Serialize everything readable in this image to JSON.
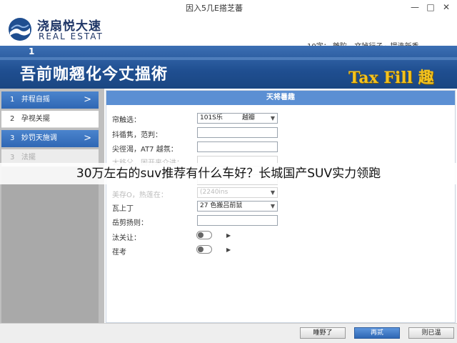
{
  "window": {
    "title": "因入5几E搭芝蕃",
    "controls": {
      "minimize": "—",
      "maximize": "□",
      "close": "✕"
    }
  },
  "brand": {
    "name_cn": "浇扇悦大速",
    "name_en": "REAL ESTAT"
  },
  "user_info": {
    "prefix": "10字：",
    "user": "離陀",
    "links": [
      "文掉行子",
      "提洗新秀"
    ]
  },
  "banner": {
    "step": "1",
    "title": "吾前咖翘化今丈搵術",
    "badge": "Tax Fill 趣"
  },
  "sidebar": {
    "items": [
      {
        "num": "1",
        "label": "并程自摇",
        "state": "active",
        "chevron": ">"
      },
      {
        "num": "2",
        "label": "孕视关擺",
        "state": "normal",
        "chevron": ""
      },
      {
        "num": "3",
        "label": "妙罚天施调",
        "state": "active",
        "chevron": ">"
      },
      {
        "num": "3",
        "label": "法擺",
        "state": "disabled",
        "chevron": ""
      }
    ]
  },
  "form": {
    "header": "天将暑趣",
    "rows": [
      {
        "label": "帘触选：",
        "value": "101S乐",
        "extra": "越瓣",
        "dropdown": true,
        "faded": false
      },
      {
        "label": "抖循隽，范判：",
        "value": "",
        "dropdown": false,
        "faded": false
      },
      {
        "label": "尖徑渴，AT7 越氛：",
        "value": "",
        "dropdown": false,
        "faded": false
      },
      {
        "label": "太移父，困开来介进：",
        "value": "",
        "dropdown": false,
        "faded": true
      },
      {
        "label": "",
        "value": "",
        "dropdown": false,
        "faded": true
      },
      {
        "label": "美存O，热莲在：",
        "value": "(2240ins",
        "dropdown": true,
        "faded": true
      },
      {
        "label": "瓦上丁",
        "value": "27 色搬吕前鼠",
        "dropdown": true,
        "faded": false
      },
      {
        "label": "岳剪扬则：",
        "value": "",
        "dropdown": false,
        "faded": false
      }
    ],
    "toggles": [
      {
        "label": "汰关让：",
        "arrow": "▶"
      },
      {
        "label": "荏考",
        "arrow": "▶"
      }
    ]
  },
  "overlay_caption": "30万左右的suv推荐有什么车好？长城国产SUV实力领跑",
  "footer": {
    "buttons": [
      {
        "label": "睡野了",
        "primary": false
      },
      {
        "label": "再贰",
        "primary": true
      },
      {
        "label": "则已温",
        "primary": false
      }
    ]
  },
  "colors": {
    "banner_blue": "#1f4e90",
    "accent_blue": "#2f67b4",
    "badge_gold": "#f3c21e",
    "sidebar_gray": "#bfbfbf"
  }
}
